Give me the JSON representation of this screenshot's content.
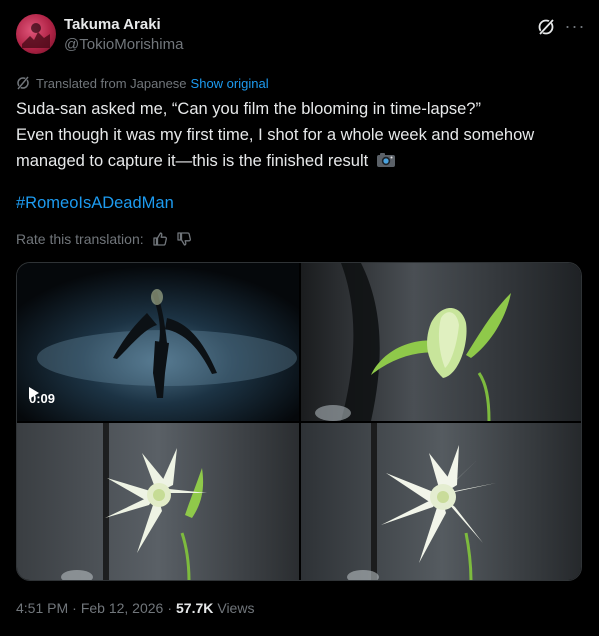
{
  "author": {
    "name": "Takuma Araki",
    "handle": "@TokioMorishima",
    "avatar_color": "#b02346"
  },
  "translation": {
    "notice": "Translated from Japanese",
    "show_original": "Show original",
    "rate_label": "Rate this translation:"
  },
  "tweet": {
    "lines": [
      "Suda-san asked me, “Can you film the blooming in time-lapse?”",
      "Even though it was my first time, I shot for a whole week and somehow",
      "managed to capture it—this is the finished result"
    ],
    "hashtag": "#RomeoIsADeadMan"
  },
  "media": {
    "video_duration": "0:09",
    "items": [
      "video",
      "photo",
      "photo",
      "photo"
    ]
  },
  "meta": {
    "time": "4:51 PM",
    "date": "Feb 12, 2026",
    "views_count": "57.7K",
    "views_label": "Views"
  },
  "colors": {
    "link": "#1d9bf0",
    "muted": "#71767b",
    "text": "#e7e9ea",
    "background": "#000000"
  },
  "icons": [
    "grok-icon",
    "more-icon",
    "translate-icon",
    "thumbs-up-icon",
    "thumbs-down-icon",
    "camera-emoji",
    "play-icon"
  ]
}
